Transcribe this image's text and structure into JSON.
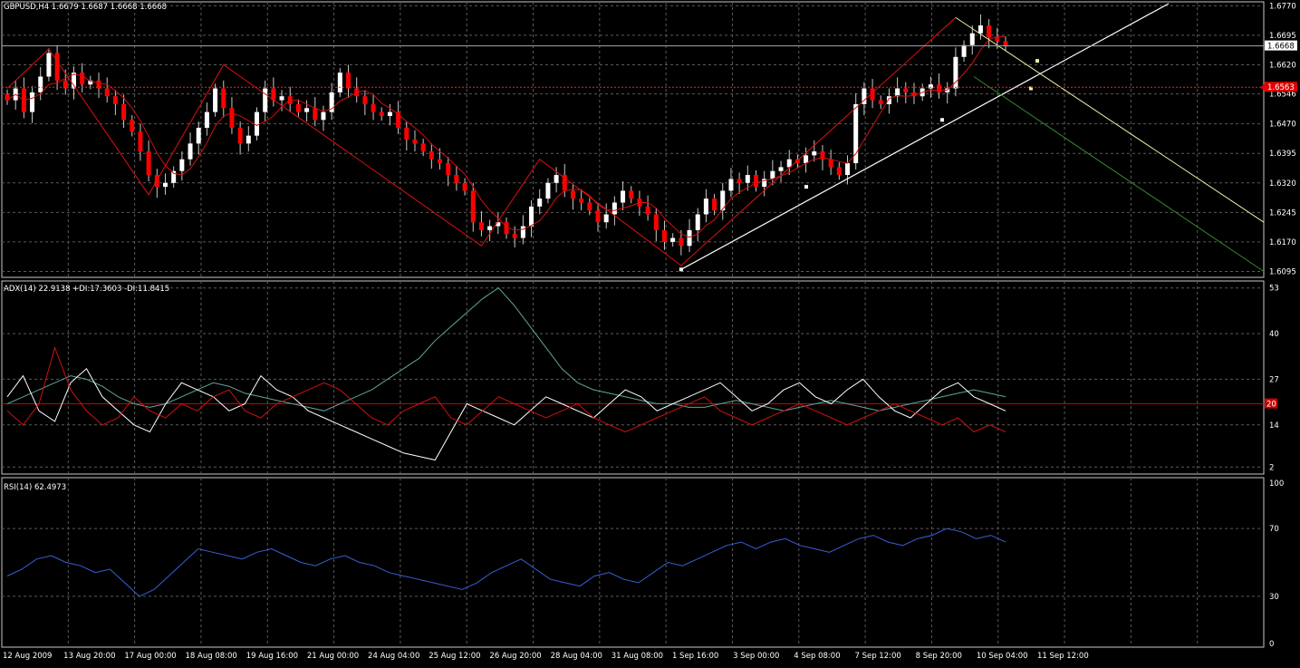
{
  "colors": {
    "background": "#000000",
    "grid": "#5a5a5a",
    "frame": "#c8c8c8",
    "bull_candle": "#ffffff",
    "bear_candle": "#ff0000",
    "wick": "#c8c8c8",
    "envelope": "#d01010",
    "zigzag": "#e01010",
    "trendline": "#ffffff",
    "channel": "#f0f0a0",
    "channel_lower": "#2e8b2e",
    "adx": "#5fa59a",
    "plus_di": "#ffffff",
    "minus_di": "#d01010",
    "level_20": "#cc0000",
    "rsi": "#3a5fd8",
    "bid_line": "#9aa9b8",
    "ask_line": "#ff2020"
  },
  "main_panel": {
    "title": "GBPUSD,H4  1.6679 1.6687 1.6668 1.6668",
    "price_ticks": [
      "1.6770",
      "1.6695",
      "1.6620",
      "1.6546",
      "1.6470",
      "1.6395",
      "1.6320",
      "1.6245",
      "1.6170",
      "1.6095"
    ],
    "bid_tag": "1.6668",
    "ask_tag": "1.6563"
  },
  "adx_panel": {
    "title": "ADX(14) 22.9138 +DI:17.3603 -DI:11.8415",
    "ticks": [
      "53",
      "40",
      "27",
      "20",
      "14",
      "2"
    ],
    "level_tag": "20"
  },
  "rsi_panel": {
    "title": "RSI(14) 62.4973",
    "ticks": [
      "100",
      "70",
      "30",
      "0"
    ]
  },
  "time_axis": {
    "labels": [
      "12 Aug 2009",
      "13 Aug 20:00",
      "17 Aug 00:00",
      "18 Aug 08:00",
      "19 Aug 16:00",
      "21 Aug 00:00",
      "24 Aug 04:00",
      "25 Aug 12:00",
      "26 Aug 20:00",
      "28 Aug 04:00",
      "31 Aug 08:00",
      "1 Sep 16:00",
      "3 Sep 00:00",
      "4 Sep 08:00",
      "7 Sep 12:00",
      "8 Sep 20:00",
      "10 Sep 04:00",
      "11 Sep 12:00"
    ]
  },
  "chart_data": [
    {
      "type": "candlestick",
      "title": "GBPUSD,H4  1.6679 1.6687 1.6668 1.6668",
      "ylim": [
        1.608,
        1.678
      ],
      "x_labels": [
        "12 Aug 2009",
        "13 Aug 20:00",
        "17 Aug 00:00",
        "18 Aug 08:00",
        "19 Aug 16:00",
        "21 Aug 00:00",
        "24 Aug 04:00",
        "25 Aug 12:00",
        "26 Aug 20:00",
        "28 Aug 04:00",
        "31 Aug 08:00",
        "1 Sep 16:00",
        "3 Sep 00:00",
        "4 Sep 08:00",
        "7 Sep 12:00",
        "8 Sep 20:00",
        "10 Sep 04:00",
        "11 Sep 12:00"
      ],
      "close_path": [
        1.653,
        1.656,
        1.65,
        1.655,
        1.659,
        1.665,
        1.658,
        1.656,
        1.66,
        1.657,
        1.658,
        1.656,
        1.654,
        1.652,
        1.648,
        1.645,
        1.64,
        1.634,
        1.631,
        1.632,
        1.635,
        1.638,
        1.642,
        1.646,
        1.65,
        1.656,
        1.651,
        1.646,
        1.642,
        1.644,
        1.65,
        1.656,
        1.653,
        1.654,
        1.652,
        1.65,
        1.651,
        1.648,
        1.65,
        1.655,
        1.66,
        1.656,
        1.654,
        1.652,
        1.65,
        1.649,
        1.65,
        1.646,
        1.643,
        1.642,
        1.64,
        1.638,
        1.637,
        1.634,
        1.632,
        1.63,
        1.622,
        1.62,
        1.621,
        1.622,
        1.619,
        1.618,
        1.621,
        1.626,
        1.628,
        1.632,
        1.634,
        1.63,
        1.628,
        1.627,
        1.625,
        1.622,
        1.624,
        1.627,
        1.63,
        1.628,
        1.626,
        1.624,
        1.62,
        1.617,
        1.618,
        1.616,
        1.62,
        1.624,
        1.628,
        1.625,
        1.63,
        1.633,
        1.632,
        1.634,
        1.631,
        1.633,
        1.635,
        1.636,
        1.638,
        1.637,
        1.639,
        1.64,
        1.638,
        1.636,
        1.634,
        1.637,
        1.652,
        1.656,
        1.653,
        1.652,
        1.654,
        1.656,
        1.655,
        1.654,
        1.656,
        1.657,
        1.655,
        1.656,
        1.664,
        1.667,
        1.67,
        1.672,
        1.669,
        1.668,
        1.6668
      ],
      "series": [
        {
          "name": "ADX",
          "values": [
            20,
            22,
            24,
            26,
            28,
            27,
            25,
            22,
            20,
            19,
            20,
            22,
            24,
            26,
            25,
            23,
            22,
            21,
            20,
            19,
            18,
            20,
            22,
            24,
            27,
            30,
            33,
            38,
            42,
            46,
            50,
            53,
            48,
            42,
            36,
            30,
            26,
            24,
            23,
            22,
            21,
            20,
            20,
            19,
            19,
            20,
            21,
            20,
            19,
            18,
            19,
            20,
            21,
            20,
            19,
            18,
            19,
            20,
            21,
            22,
            23,
            24,
            23,
            22
          ]
        },
        {
          "name": "+DI",
          "values": [
            22,
            28,
            18,
            15,
            26,
            30,
            22,
            18,
            14,
            12,
            20,
            26,
            24,
            22,
            18,
            20,
            28,
            24,
            22,
            18,
            16,
            14,
            12,
            10,
            8,
            6,
            5,
            4,
            12,
            20,
            18,
            16,
            14,
            18,
            22,
            20,
            18,
            16,
            20,
            24,
            22,
            18,
            20,
            22,
            24,
            26,
            22,
            18,
            20,
            24,
            26,
            22,
            20,
            24,
            27,
            22,
            18,
            16,
            20,
            24,
            26,
            22,
            20,
            18
          ]
        },
        {
          "name": "-DI",
          "values": [
            18,
            14,
            20,
            36,
            24,
            18,
            14,
            16,
            22,
            18,
            16,
            20,
            18,
            22,
            24,
            18,
            16,
            20,
            22,
            24,
            26,
            24,
            20,
            16,
            14,
            18,
            20,
            22,
            16,
            14,
            18,
            22,
            20,
            18,
            16,
            18,
            20,
            16,
            14,
            12,
            14,
            16,
            18,
            20,
            22,
            18,
            16,
            14,
            16,
            18,
            20,
            18,
            16,
            14,
            16,
            18,
            20,
            18,
            16,
            14,
            16,
            12,
            14,
            12
          ]
        },
        {
          "name": "RSI",
          "values": [
            42,
            46,
            52,
            54,
            50,
            48,
            44,
            46,
            38,
            30,
            34,
            42,
            50,
            58,
            56,
            54,
            52,
            56,
            58,
            54,
            50,
            48,
            52,
            54,
            50,
            48,
            44,
            42,
            40,
            38,
            36,
            34,
            38,
            44,
            48,
            52,
            46,
            40,
            38,
            36,
            42,
            44,
            40,
            38,
            44,
            50,
            48,
            52,
            56,
            60,
            62,
            58,
            62,
            64,
            60,
            58,
            56,
            60,
            64,
            66,
            62,
            60,
            64,
            66,
            70,
            68,
            64,
            66,
            62
          ]
        }
      ]
    }
  ]
}
